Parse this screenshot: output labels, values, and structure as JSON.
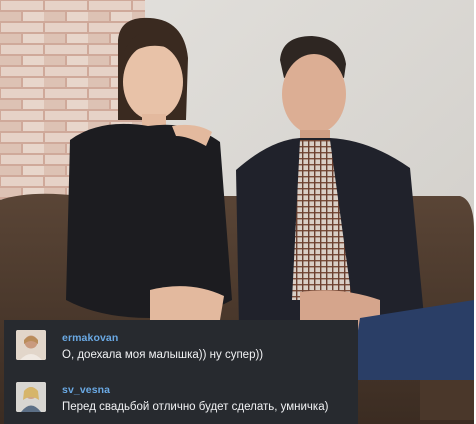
{
  "comments": [
    {
      "username": "ermakovan",
      "text": "О, доехала моя малышка)) ну супер))",
      "avatar_icon": "user-avatar-photo"
    },
    {
      "username": "sv_vesna",
      "text": "Перед свадьбой отлично будет сделать, умничка)",
      "avatar_icon": "user-avatar-photo"
    }
  ],
  "colors": {
    "overlay_background": "#272a2f",
    "username": "#6aa9e4",
    "comment_text": "#f1f2f4"
  }
}
